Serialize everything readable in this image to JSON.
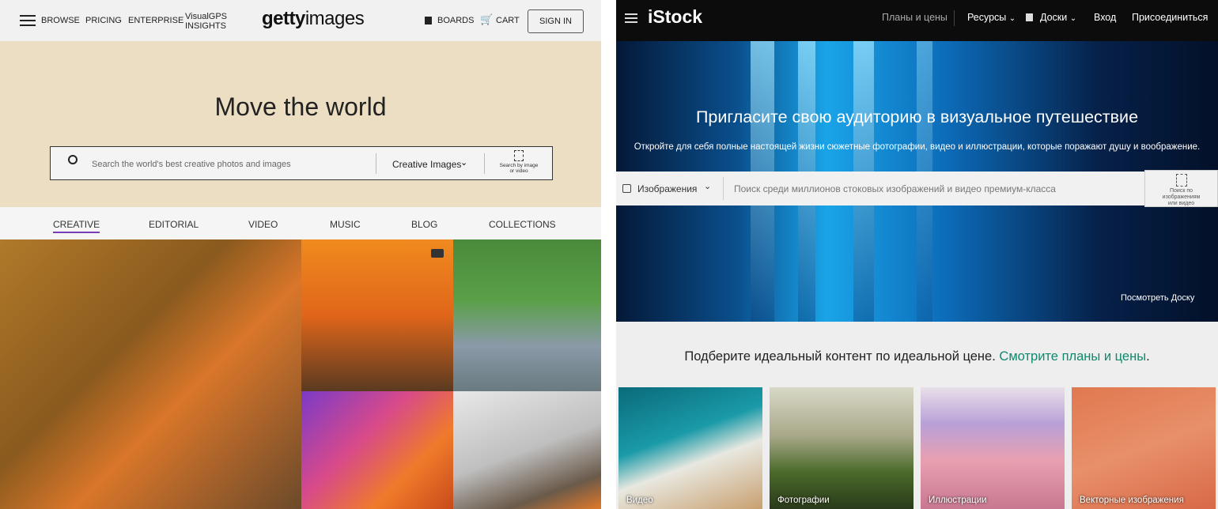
{
  "getty": {
    "nav": {
      "browse": "BROWSE",
      "pricing": "PRICING",
      "enterprise": "ENTERPRISE",
      "visualgps_line1": "VisualGPS",
      "visualgps_line2": "INSIGHTS",
      "boards": "BOARDS",
      "cart": "CART",
      "sign_in": "SIGN IN"
    },
    "logo": {
      "bold": "getty",
      "light": "images"
    },
    "hero": {
      "title": "Move the world",
      "search_placeholder": "Search the world's best creative photos and images",
      "search_type": "Creative Images",
      "visual_search_line1": "Search by image",
      "visual_search_line2": "or video"
    },
    "tabs": [
      "CREATIVE",
      "EDITORIAL",
      "VIDEO",
      "MUSIC",
      "BLOG",
      "COLLECTIONS"
    ],
    "active_tab": "CREATIVE",
    "accent": "#7a3db8"
  },
  "istock": {
    "logo": "iStock",
    "nav": {
      "plans": "Планы и цены",
      "resources": "Ресурсы",
      "boards": "Доски",
      "login": "Вход",
      "join": "Присоединиться"
    },
    "hero": {
      "title": "Пригласите свою аудиторию в визуальное путешествие",
      "subtitle": "Откройте для себя полные настоящей жизни сюжетные фотографии, видео и иллюстрации, которые поражают душу и воображение.",
      "search_type": "Изображения",
      "search_placeholder": "Поиск среди миллионов стоковых изображений и видео премиум-класса",
      "visual_search": "Поиск по изображениям или видео",
      "view_board": "Посмотреть Доску"
    },
    "promo": {
      "text": "Подберите идеальный контент по идеальной цене.",
      "link": "Смотрите планы и цены",
      "link_color": "#0f8a6e"
    },
    "cards": [
      "Видео",
      "Фотографии",
      "Иллюстрации",
      "Векторные изображения"
    ]
  }
}
